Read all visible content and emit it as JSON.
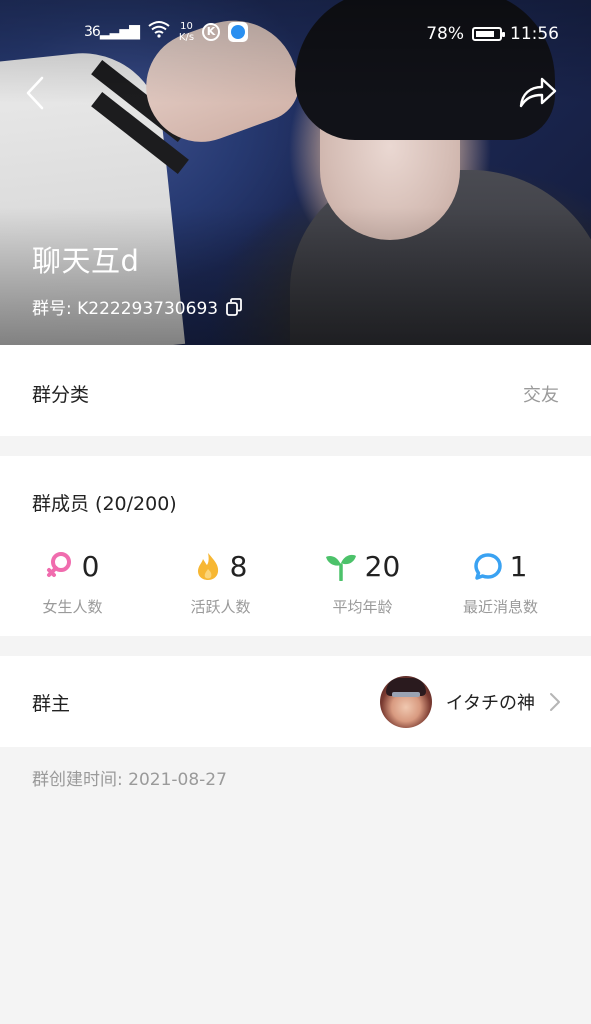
{
  "status_bar": {
    "signal": "36",
    "net_speed_value": "10",
    "net_speed_unit": "K/s",
    "circle_icon_letter": "K",
    "battery_pct": "78%",
    "time": "11:56"
  },
  "hero": {
    "group_name": "聊天互d",
    "group_id": "群号: K222293730693"
  },
  "category": {
    "label": "群分类",
    "value": "交友"
  },
  "members": {
    "title": "群成员 (20/200)",
    "stats": [
      {
        "value": "0",
        "label": "女生人数",
        "icon": "female-icon",
        "color": "#f06cae"
      },
      {
        "value": "8",
        "label": "活跃人数",
        "icon": "flame-icon",
        "color": "#f7b733"
      },
      {
        "value": "20",
        "label": "平均年龄",
        "icon": "sprout-icon",
        "color": "#4cc26a"
      },
      {
        "value": "1",
        "label": "最近消息数",
        "icon": "chat-bubble-icon",
        "color": "#3aa2f2"
      }
    ]
  },
  "owner": {
    "label": "群主",
    "name": "イタチの神"
  },
  "created": "群创建时间: 2021-08-27"
}
